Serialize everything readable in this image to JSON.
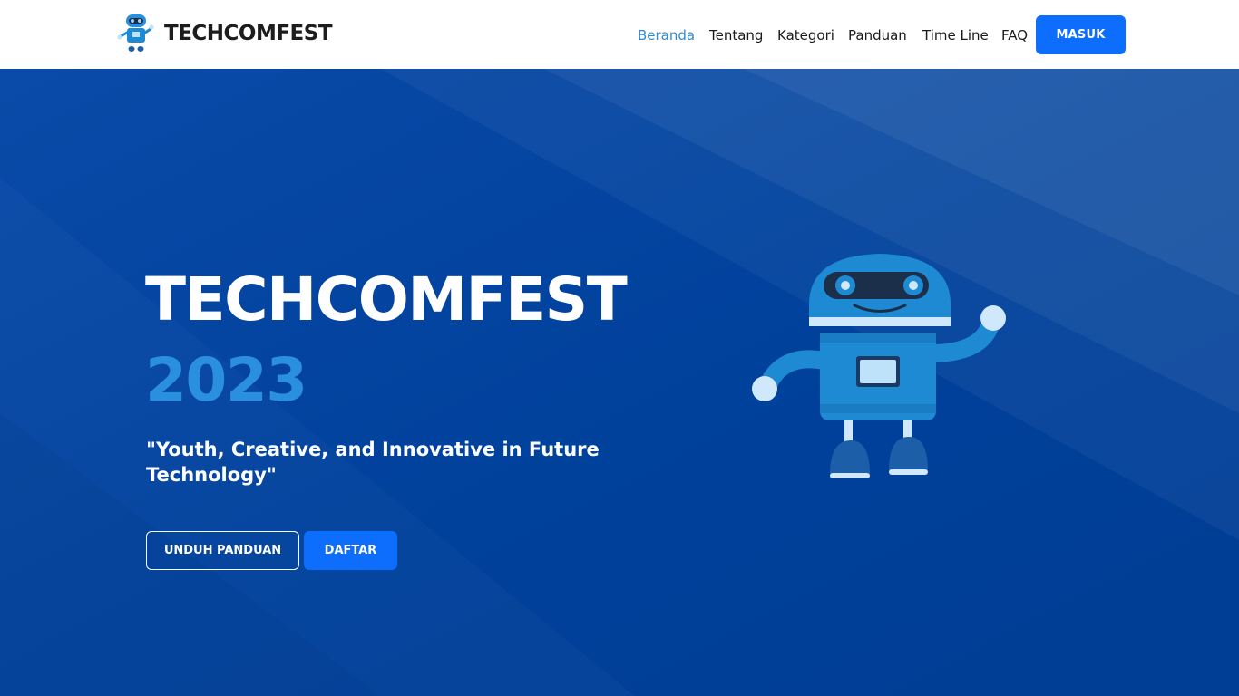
{
  "brand": {
    "name": "TECHCOMFEST",
    "logo_icon": "robot-logo-icon"
  },
  "nav": {
    "items": [
      {
        "label": "Beranda",
        "active": true
      },
      {
        "label": "Tentang",
        "active": false
      },
      {
        "label": "Kategori",
        "active": false
      },
      {
        "label": "Panduan",
        "active": false
      },
      {
        "label": "Time Line",
        "active": false
      },
      {
        "label": "FAQ",
        "active": false
      }
    ],
    "login_label": "MASUK"
  },
  "hero": {
    "title": "TECHCOMFEST",
    "year": "2023",
    "tagline": "\"Youth, Creative, and Innovative in Future Technology\"",
    "download_label": "UNDUH PANDUAN",
    "register_label": "DAFTAR",
    "illustration_icon": "waving-robot-icon"
  },
  "colors": {
    "nav_active": "#2f8ad6",
    "primary_button": "#0d6efd",
    "hero_background": "#003f99",
    "year_accent": "#2b8fe0",
    "robot_body": "#1f8ad4"
  }
}
